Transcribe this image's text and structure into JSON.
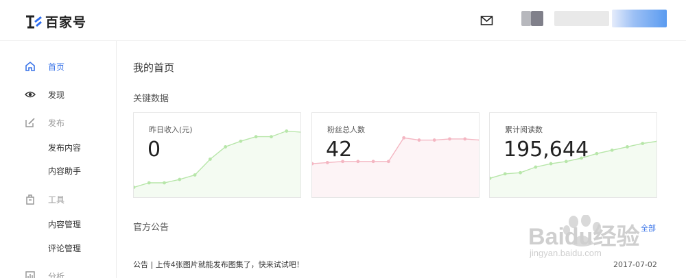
{
  "header": {
    "logo_text": "百家号",
    "icons": {
      "mail": "mail-icon"
    }
  },
  "sidebar": {
    "items": [
      {
        "label": "首页",
        "icon": "home-icon",
        "active": true
      },
      {
        "label": "发现",
        "icon": "eye-icon",
        "active": false
      },
      {
        "label": "发布",
        "icon": "edit-icon",
        "active": false,
        "group": true
      },
      {
        "label": "工具",
        "icon": "toolbox-icon",
        "active": false,
        "group": true
      },
      {
        "label": "分析",
        "icon": "chart-icon",
        "active": false,
        "group": true
      }
    ],
    "publish_sub": [
      "发布内容",
      "内容助手"
    ],
    "tools_sub": [
      "内容管理",
      "评论管理"
    ]
  },
  "main": {
    "title": "我的首页",
    "key_data_title": "关键数据",
    "cards": [
      {
        "label": "昨日收入(元)",
        "value": "0",
        "color": "#b7e6a9",
        "trend": [
          10,
          14,
          14,
          17,
          21,
          35,
          46,
          51,
          55,
          55,
          60,
          59
        ]
      },
      {
        "label": "粉丝总人数",
        "value": "42",
        "color": "#f4b6c2",
        "trend": [
          31,
          32,
          33,
          33,
          33,
          33,
          54,
          52,
          52,
          53,
          53,
          52
        ]
      },
      {
        "label": "累计阅读数",
        "value": "195,644",
        "color": "#b7e6a9",
        "trend": [
          18,
          22,
          23,
          28,
          31,
          33,
          36,
          40,
          43,
          46,
          49,
          51
        ]
      }
    ],
    "notice_title": "官方公告",
    "all_label": "全部",
    "notice_text": "公告 | 上传4张图片就能发布图集了，快来试试吧！",
    "notice_date": "2017-07-02"
  },
  "watermark": {
    "brand": "Baidu经验",
    "url": "jingyan.baidu.com"
  },
  "colors": {
    "accent": "#3a74e8",
    "border": "#e6e6e6"
  }
}
